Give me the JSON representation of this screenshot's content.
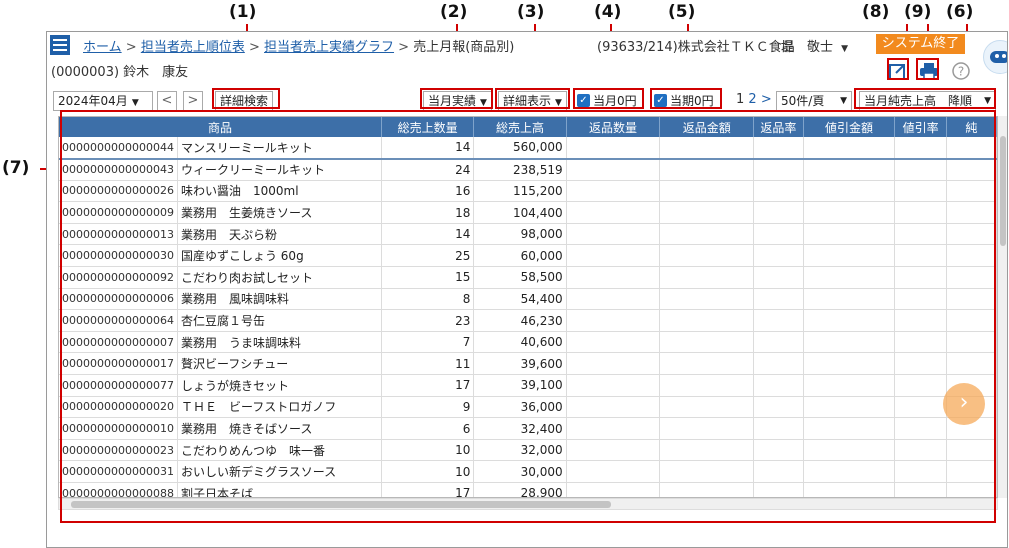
{
  "callouts": [
    "(1)",
    "(2)",
    "(3)",
    "(4)",
    "(5)",
    "(8)",
    "(9)",
    "(6)",
    "(7)"
  ],
  "header": {
    "breadcrumb": [
      "ホーム",
      "担当者売上順位表",
      "担当者売上実績グラフ"
    ],
    "breadcrumb_separator": ">",
    "current_page": "売上月報(商品別)",
    "company": "(93633/214)株式会社ＴＫＣ食品",
    "user": "堤　敬士",
    "user_caret": "▼",
    "system_exit": "システム終了"
  },
  "user_line": "(0000003) 鈴木　康友",
  "icons": {
    "menu": "hamburger-menu-icon",
    "open_external": "open-external-icon",
    "print": "printer-icon",
    "help": "help-icon",
    "mascot": "assistant-mascot-icon"
  },
  "toolbar": {
    "month": "2024年04月",
    "prev": "<",
    "next": ">",
    "detail_search": "詳細検索",
    "monthly_actual": "当月実績",
    "detail_display": "詳細表示",
    "zero_month": "当月0円",
    "zero_period": "当期0円",
    "pages": [
      "1",
      "2"
    ],
    "page_next": ">",
    "per_page": "50件/頁",
    "sort": "当月純売上高　降順"
  },
  "table": {
    "columns": [
      "商品",
      "総売上数量",
      "総売上高",
      "返品数量",
      "返品金額",
      "返品率",
      "値引金額",
      "値引率",
      "純"
    ],
    "rows": [
      {
        "code": "0000000000000044",
        "name": "マンスリーミールキット",
        "qty": "14",
        "sales": "560,000"
      },
      {
        "code": "0000000000000043",
        "name": "ウィークリーミールキット",
        "qty": "24",
        "sales": "238,519"
      },
      {
        "code": "0000000000000026",
        "name": "味わい醤油　1000ml",
        "qty": "16",
        "sales": "115,200"
      },
      {
        "code": "0000000000000009",
        "name": "業務用　生姜焼きソース",
        "qty": "18",
        "sales": "104,400"
      },
      {
        "code": "0000000000000013",
        "name": "業務用　天ぷら粉",
        "qty": "14",
        "sales": "98,000"
      },
      {
        "code": "0000000000000030",
        "name": "国産ゆずこしょう 60g",
        "qty": "25",
        "sales": "60,000"
      },
      {
        "code": "0000000000000092",
        "name": "こだわり肉お試しセット",
        "qty": "15",
        "sales": "58,500"
      },
      {
        "code": "0000000000000006",
        "name": "業務用　風味調味料",
        "qty": "8",
        "sales": "54,400"
      },
      {
        "code": "0000000000000064",
        "name": "杏仁豆腐１号缶",
        "qty": "23",
        "sales": "46,230"
      },
      {
        "code": "0000000000000007",
        "name": "業務用　うま味調味料",
        "qty": "7",
        "sales": "40,600"
      },
      {
        "code": "0000000000000017",
        "name": "贅沢ビーフシチュー",
        "qty": "11",
        "sales": "39,600"
      },
      {
        "code": "0000000000000077",
        "name": "しょうが焼きセット",
        "qty": "17",
        "sales": "39,100"
      },
      {
        "code": "0000000000000020",
        "name": "ＴＨＥ　ビーフストロガノフ",
        "qty": "9",
        "sales": "36,000"
      },
      {
        "code": "0000000000000010",
        "name": "業務用　焼きそばソース",
        "qty": "6",
        "sales": "32,400"
      },
      {
        "code": "0000000000000023",
        "name": "こだわりめんつゆ　味一番",
        "qty": "10",
        "sales": "32,000"
      },
      {
        "code": "0000000000000031",
        "name": "おいしい新デミグラスソース",
        "qty": "10",
        "sales": "30,000"
      },
      {
        "code": "0000000000000088",
        "name": "割子日本そば",
        "qty": "17",
        "sales": "28,900"
      }
    ]
  },
  "colors": {
    "header_blue": "#3d6fa8",
    "link_blue": "#1f5fa8",
    "orange": "#f28a1e",
    "annotation_red": "#d00000"
  },
  "fab_next": "›"
}
